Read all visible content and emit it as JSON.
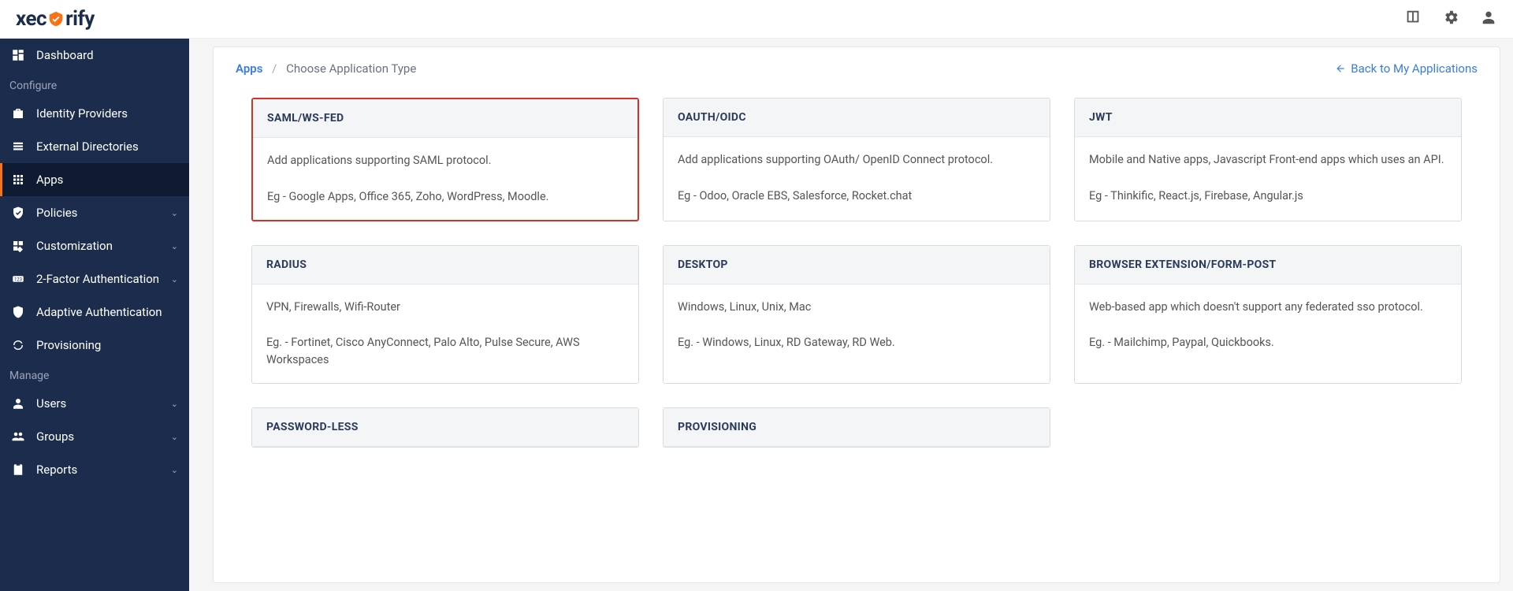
{
  "logo": {
    "pre": "xec",
    "post": "rify"
  },
  "topicons": {
    "book": "book-icon",
    "gear": "gear-icon",
    "user": "user-icon"
  },
  "sidebar": {
    "dashboard": "Dashboard",
    "heading_configure": "Configure",
    "idp": "Identity Providers",
    "extdir": "External Directories",
    "apps": "Apps",
    "policies": "Policies",
    "customization": "Customization",
    "twofa": "2-Factor Authentication",
    "adaptive": "Adaptive Authentication",
    "provisioning": "Provisioning",
    "heading_manage": "Manage",
    "users": "Users",
    "groups": "Groups",
    "reports": "Reports"
  },
  "breadcrumb": {
    "apps": "Apps",
    "sep": "/",
    "current": "Choose Application Type",
    "back": "Back to My Applications"
  },
  "cards": {
    "saml": {
      "title": "SAML/WS-FED",
      "desc": "Add applications supporting SAML protocol.",
      "eg": "Eg - Google Apps, Office 365, Zoho, WordPress, Moodle."
    },
    "oauth": {
      "title": "OAUTH/OIDC",
      "desc": "Add applications supporting OAuth/ OpenID Connect protocol.",
      "eg": "Eg - Odoo, Oracle EBS, Salesforce, Rocket.chat"
    },
    "jwt": {
      "title": "JWT",
      "desc": "Mobile and Native apps, Javascript Front-end apps which uses an API.",
      "eg": "Eg - Thinkific, React.js, Firebase, Angular.js"
    },
    "radius": {
      "title": "RADIUS",
      "desc": "VPN, Firewalls, Wifi-Router",
      "eg": "Eg. - Fortinet, Cisco AnyConnect, Palo Alto, Pulse Secure, AWS Workspaces"
    },
    "desktop": {
      "title": "DESKTOP",
      "desc": "Windows, Linux, Unix, Mac",
      "eg": "Eg. - Windows, Linux, RD Gateway, RD Web."
    },
    "browser": {
      "title": "BROWSER EXTENSION/FORM-POST",
      "desc": "Web-based app which doesn't support any federated sso protocol.",
      "eg": "Eg. - Mailchimp, Paypal, Quickbooks."
    },
    "pwless": {
      "title": "PASSWORD-LESS"
    },
    "prov": {
      "title": "PROVISIONING"
    }
  }
}
